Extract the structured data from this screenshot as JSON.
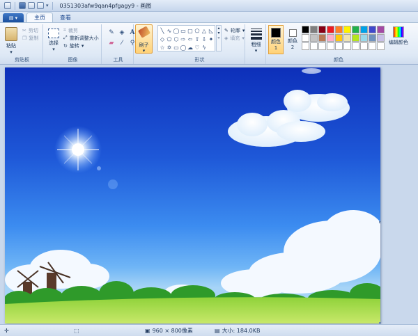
{
  "window": {
    "title": "0351303afw9qan4pfgagy9 - 画图"
  },
  "tabs": [
    {
      "label": "主页",
      "active": true
    },
    {
      "label": "查看",
      "active": false
    }
  ],
  "ribbon": {
    "clipboard": {
      "paste_label": "粘贴",
      "cut_label": "剪切",
      "copy_label": "复制",
      "group_label": "剪贴板"
    },
    "image": {
      "select_label": "选择",
      "crop_label": "裁剪",
      "resize_label": "重新调整大小",
      "rotate_label": "旋转",
      "group_label": "图像"
    },
    "tools": {
      "group_label": "工具",
      "items": [
        "pencil-icon",
        "fill-icon",
        "text-icon",
        "eraser-icon",
        "color-picker-icon",
        "magnifier-icon"
      ]
    },
    "brush": {
      "label": "刷子"
    },
    "shapes": {
      "outline_label": "轮廓",
      "fill_label": "填充",
      "group_label": "形状"
    },
    "size": {
      "label": "粗细"
    },
    "colors": {
      "color1_label": "颜色 1",
      "color2_label": "颜色 2",
      "edit_label": "编辑颜色",
      "group_label": "颜色",
      "color1": "#000000",
      "color2": "#ffffff",
      "palette": [
        "#000000",
        "#7f7f7f",
        "#880015",
        "#ed1c24",
        "#ff7f27",
        "#fff200",
        "#22b14c",
        "#00a2e8",
        "#3f48cc",
        "#a349a4",
        "#ffffff",
        "#c3c3c3",
        "#b97a57",
        "#ffaec9",
        "#ffc90e",
        "#efe4b0",
        "#b5e61d",
        "#99d9ea",
        "#7092be",
        "#c8bfe7",
        "#ffffff",
        "#ffffff",
        "#ffffff",
        "#ffffff",
        "#ffffff",
        "#ffffff",
        "#ffffff",
        "#ffffff",
        "#ffffff",
        "#ffffff"
      ]
    }
  },
  "status": {
    "dimensions": "960 × 800像素",
    "size": "大小: 184.0KB"
  }
}
